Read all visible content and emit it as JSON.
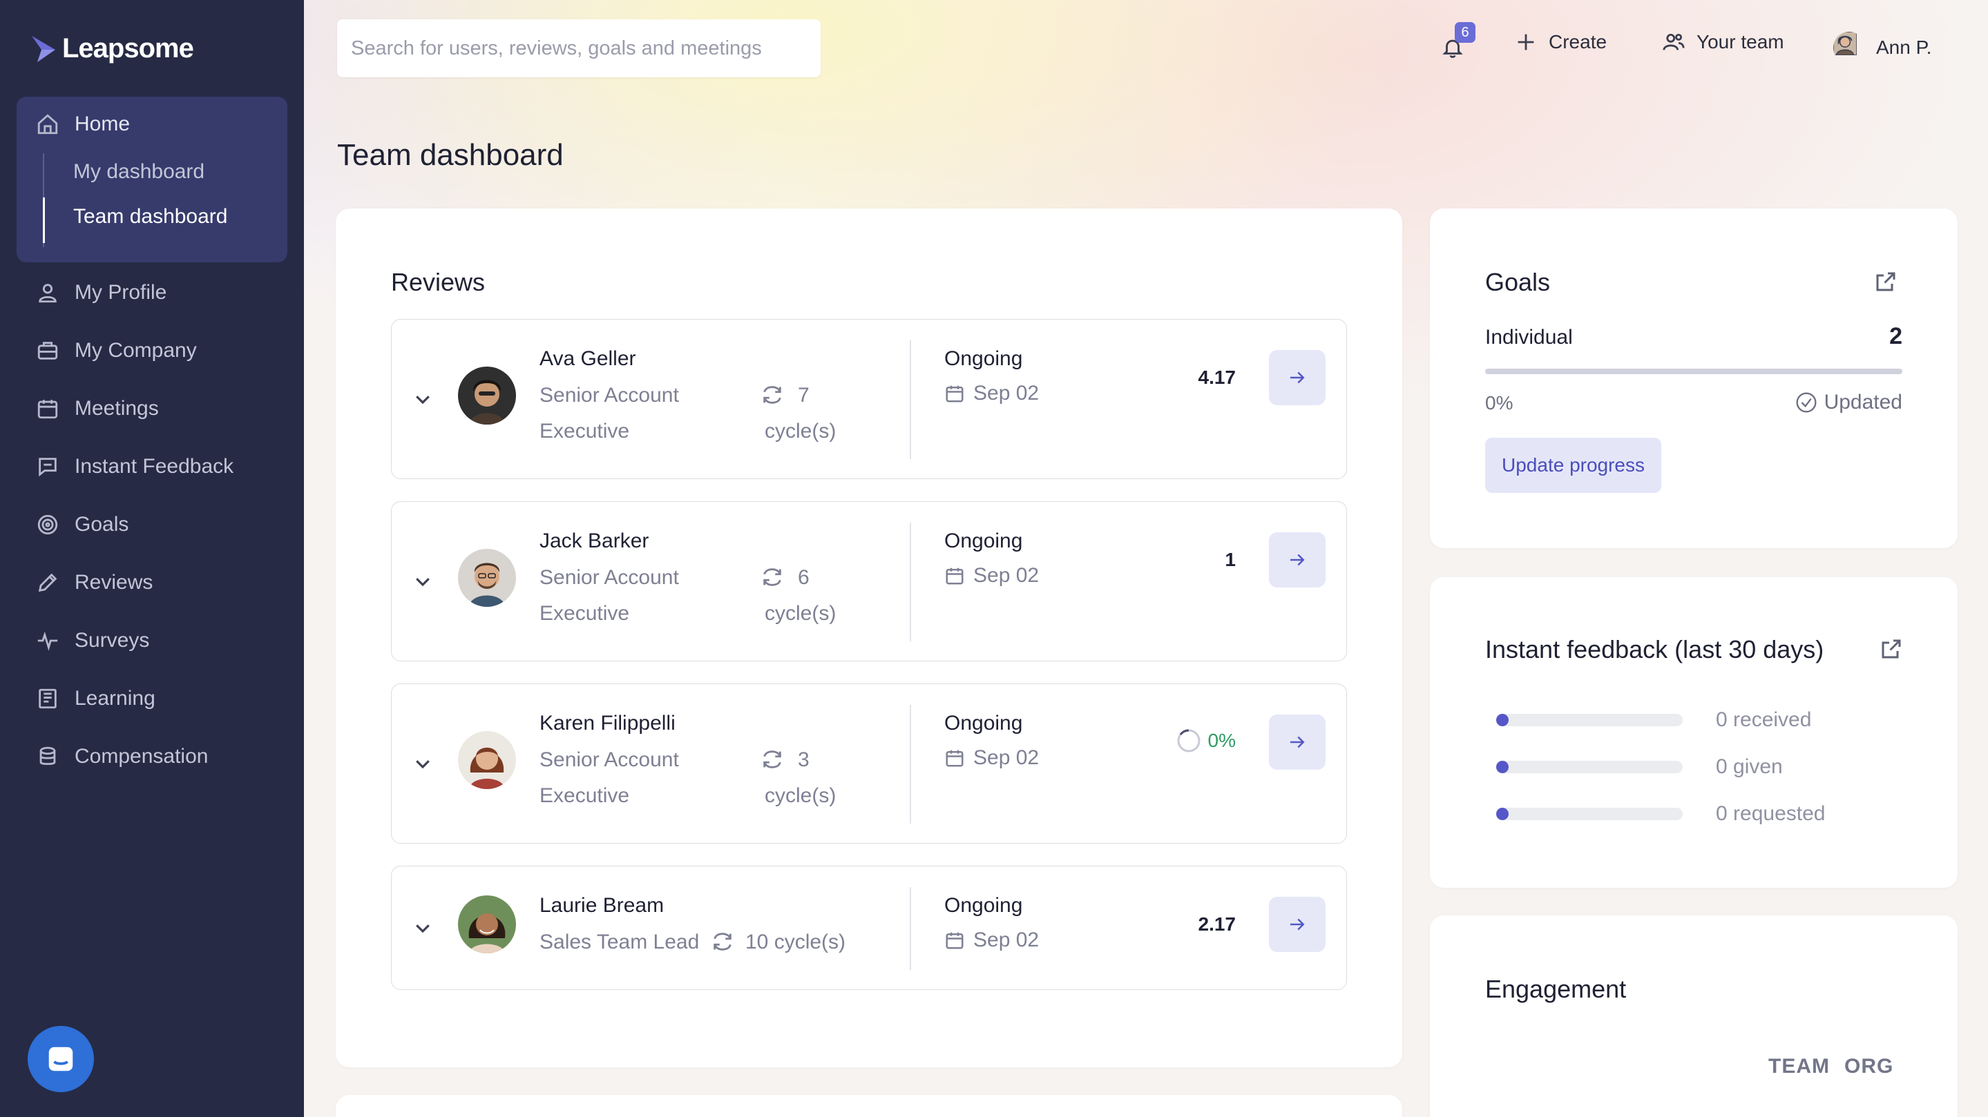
{
  "brand": {
    "name": "Leapsome",
    "accent": "#6b6dd6",
    "sidebar_bg": "#262a44"
  },
  "sidebar": {
    "home_label": "Home",
    "sub_items": [
      "My dashboard",
      "Team dashboard"
    ],
    "items": [
      {
        "label": "My Profile",
        "icon": "user-icon"
      },
      {
        "label": "My Company",
        "icon": "briefcase-icon"
      },
      {
        "label": "Meetings",
        "icon": "calendar-icon"
      },
      {
        "label": "Instant Feedback",
        "icon": "chat-icon"
      },
      {
        "label": "Goals",
        "icon": "target-icon"
      },
      {
        "label": "Reviews",
        "icon": "pen-icon"
      },
      {
        "label": "Surveys",
        "icon": "pulse-icon"
      },
      {
        "label": "Learning",
        "icon": "book-icon"
      },
      {
        "label": "Compensation",
        "icon": "coins-icon"
      }
    ]
  },
  "topbar": {
    "search_placeholder": "Search for users, reviews, goals and meetings",
    "notifications_count": "6",
    "create_label": "Create",
    "team_label": "Your team",
    "user_name": "Ann P."
  },
  "page": {
    "title": "Team dashboard"
  },
  "reviews": {
    "title": "Reviews",
    "rows": [
      {
        "name": "Ava Geller",
        "title_line1": "Senior Account",
        "title_line2": "Executive",
        "cycles_line1": "7",
        "cycles_line2": "cycle(s)",
        "status": "Ongoing",
        "date": "Sep 02",
        "score": "4.17"
      },
      {
        "name": "Jack Barker",
        "title_line1": "Senior Account",
        "title_line2": "Executive",
        "cycles_line1": "6",
        "cycles_line2": "cycle(s)",
        "status": "Ongoing",
        "date": "Sep 02",
        "score": "1"
      },
      {
        "name": "Karen Filippelli",
        "title_line1": "Senior Account",
        "title_line2": "Executive",
        "cycles_line1": "3",
        "cycles_line2": "cycle(s)",
        "status": "Ongoing",
        "date": "Sep 02",
        "progress": "0%"
      },
      {
        "name": "Laurie Bream",
        "title_line1": "Sales Team Lead",
        "cycles_line1": "10 cycle(s)",
        "status": "Ongoing",
        "date": "Sep 02",
        "score": "2.17"
      }
    ]
  },
  "goals": {
    "title": "Goals",
    "individual_label": "Individual",
    "individual_count": "2",
    "progress": "0%",
    "progress_value": 0,
    "updated_label": "Updated",
    "update_button": "Update progress"
  },
  "instant_feedback": {
    "title": "Instant feedback (last 30 days)",
    "rows": [
      "0 received",
      "0 given",
      "0 requested"
    ]
  },
  "engagement": {
    "title": "Engagement",
    "tabs": [
      "TEAM",
      "ORG"
    ]
  }
}
